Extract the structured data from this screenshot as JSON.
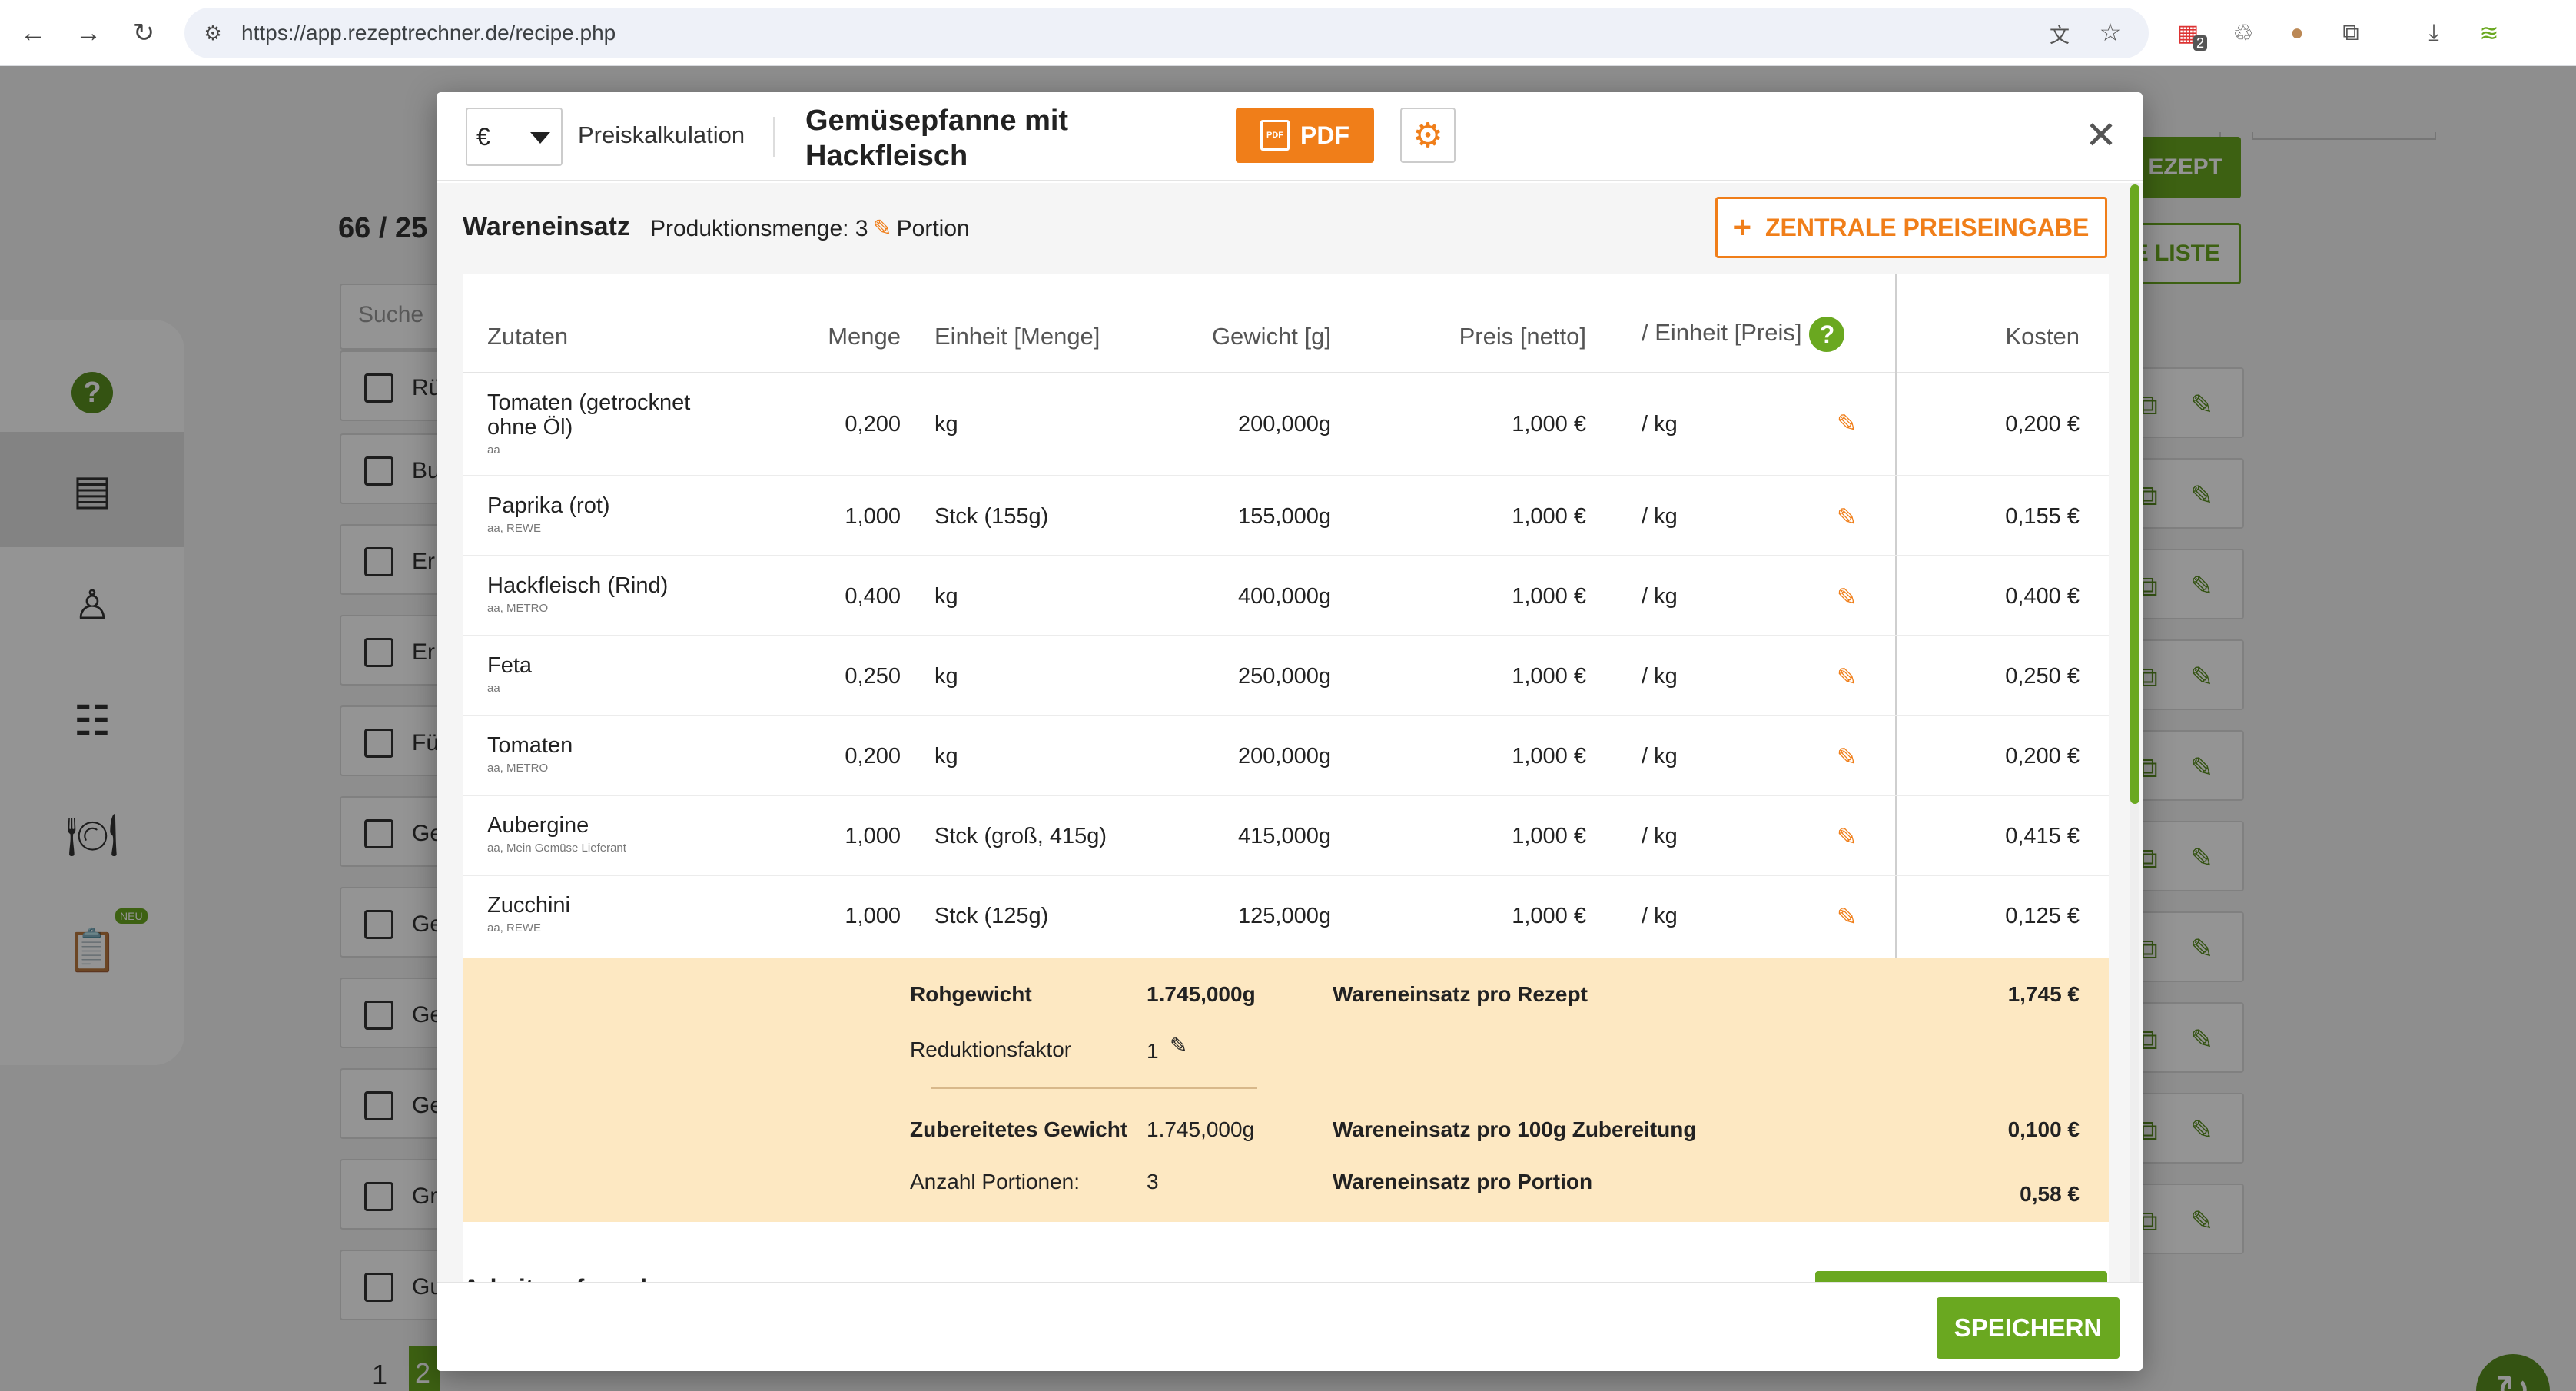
{
  "browser": {
    "url": "https://app.rezeptrechner.de/recipe.php",
    "nav_icons": [
      "back-arrow-icon",
      "forward-arrow-icon",
      "reload-icon"
    ],
    "extension_badge": "2"
  },
  "background": {
    "count_text": "66 / 25",
    "search_placeholder": "Suche",
    "row_texts": [
      "Rü",
      "Bu",
      "Er",
      "Er",
      "Fü",
      "Ge",
      "Ge",
      "Ge",
      "Ge",
      "Gr",
      "Gu"
    ],
    "btn_new_recipe": "EZEPT",
    "btn_list": "E LISTE",
    "pager": {
      "page1": "1",
      "page2": "2"
    },
    "side_badge": "NEU"
  },
  "modal": {
    "currency": "€",
    "mode_label": "Preiskalkulation",
    "recipe_title": "Gemüsepfanne mit Hackfleisch",
    "pdf_label": "PDF",
    "section_title": "Wareneinsatz",
    "production_qty_label": "Produktionsmenge: 3",
    "production_unit": "Portion",
    "central_price_btn": "ZENTRALE PREISEINGABE",
    "columns": {
      "ingredients": "Zutaten",
      "quantity": "Menge",
      "unit": "Einheit [Menge]",
      "weight": "Gewicht [g]",
      "price": "Preis [netto]",
      "price_unit": "/ Einheit [Preis]",
      "cost": "Kosten"
    },
    "rows": [
      {
        "name": "Tomaten (getrocknet ohne Öl)",
        "sub": "aa",
        "qty": "0,200",
        "unit": "kg",
        "weight": "200,000g",
        "price": "1,000 €",
        "price_unit": "/ kg",
        "cost": "0,200 €"
      },
      {
        "name": "Paprika (rot)",
        "sub": "aa, REWE",
        "qty": "1,000",
        "unit": "Stck (155g)",
        "weight": "155,000g",
        "price": "1,000 €",
        "price_unit": "/ kg",
        "cost": "0,155 €"
      },
      {
        "name": "Hackfleisch (Rind)",
        "sub": "aa, METRO",
        "qty": "0,400",
        "unit": "kg",
        "weight": "400,000g",
        "price": "1,000 €",
        "price_unit": "/ kg",
        "cost": "0,400 €"
      },
      {
        "name": "Feta",
        "sub": "aa",
        "qty": "0,250",
        "unit": "kg",
        "weight": "250,000g",
        "price": "1,000 €",
        "price_unit": "/ kg",
        "cost": "0,250 €"
      },
      {
        "name": "Tomaten",
        "sub": "aa, METRO",
        "qty": "0,200",
        "unit": "kg",
        "weight": "200,000g",
        "price": "1,000 €",
        "price_unit": "/ kg",
        "cost": "0,200 €"
      },
      {
        "name": "Aubergine",
        "sub": "aa, Mein Gemüse Lieferant",
        "qty": "1,000",
        "unit": "Stck (groß, 415g)",
        "weight": "415,000g",
        "price": "1,000 €",
        "price_unit": "/ kg",
        "cost": "0,415 €"
      },
      {
        "name": "Zucchini",
        "sub": "aa, REWE",
        "qty": "1,000",
        "unit": "Stck (125g)",
        "weight": "125,000g",
        "price": "1,000 €",
        "price_unit": "/ kg",
        "cost": "0,125 €"
      }
    ],
    "summary": {
      "raw_weight_label": "Rohgewicht",
      "raw_weight_value": "1.745,000g",
      "reduction_label": "Reduktionsfaktor",
      "reduction_value": "1",
      "prepared_weight_label": "Zubereitetes Gewicht",
      "prepared_weight_value": "1.745,000g",
      "portions_label": "Anzahl Portionen:",
      "portions_value": "3",
      "cost_recipe_label": "Wareneinsatz pro Rezept",
      "cost_recipe_value": "1,745 €",
      "cost_100g_label": "Wareneinsatz pro 100g Zubereitung",
      "cost_100g_value": "0,100 €",
      "cost_portion_label": "Wareneinsatz pro Portion",
      "cost_portion_value": "0,58 €"
    },
    "peek_heading": "Arbeitsaufwand",
    "save_label": "SPEICHERN"
  },
  "colors": {
    "accent_orange": "#f07e19",
    "accent_green": "#6aa820",
    "summary_bg": "#fde8c2"
  }
}
